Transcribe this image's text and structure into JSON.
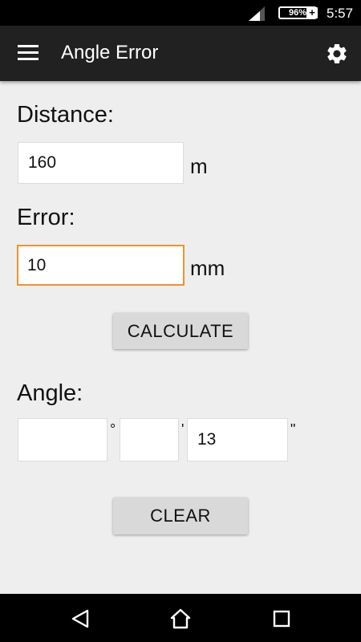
{
  "status_bar": {
    "battery": "96%",
    "time": "5:57",
    "icons": [
      "signal-icon",
      "battery-charging-icon"
    ]
  },
  "app_bar": {
    "title": "Angle Error",
    "icons": [
      "menu-icon",
      "settings-icon"
    ]
  },
  "form": {
    "distance_label": "Distance:",
    "distance_value": "160",
    "distance_unit": "m",
    "error_label": "Error:",
    "error_value": "10",
    "error_unit": "mm",
    "calculate_label": "CALCULATE",
    "angle_label": "Angle:",
    "degrees_value": "",
    "degree_mark": "°",
    "minutes_value": "",
    "minute_mark": "'",
    "seconds_value": "13",
    "second_mark": "\"",
    "clear_label": "CLEAR"
  },
  "nav_bar": {
    "icons": [
      "back-icon",
      "home-icon",
      "recents-icon"
    ]
  },
  "colors": {
    "app_bar": "#212121",
    "background": "#eeeeee",
    "focus_accent": "#f0922a",
    "button": "#d9d9d9"
  }
}
